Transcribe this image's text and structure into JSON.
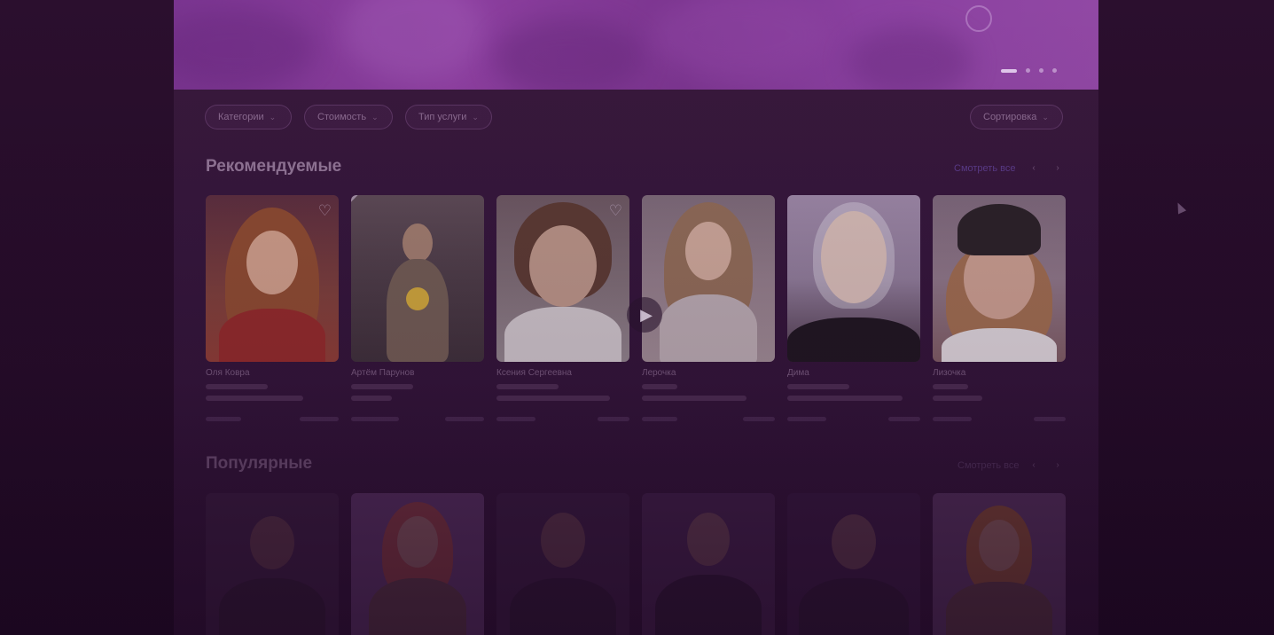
{
  "filters": [
    {
      "label": "Категории"
    },
    {
      "label": "Стоимость"
    },
    {
      "label": "Тип услуги"
    }
  ],
  "sort": {
    "label": "Сортировка"
  },
  "sections": {
    "recommended": {
      "title": "Рекомендуемые",
      "see_all": "Смотреть все"
    },
    "popular": {
      "title": "Популярные",
      "see_all": "Смотреть все"
    }
  },
  "recommended_cards": [
    {
      "name": "Оля Ковра"
    },
    {
      "name": "Артём Парунов"
    },
    {
      "name": "Ксения Сергеевна"
    },
    {
      "name": "Лерочка"
    },
    {
      "name": "Дима"
    },
    {
      "name": "Лизочка"
    }
  ],
  "hero": {
    "slides": 4,
    "active_slide": 1
  },
  "colors": {
    "accent": "#8d3fa0",
    "background": "#2a1030",
    "see_all_link": "#7a5ac8"
  },
  "icons": {
    "favorite": "heart-icon",
    "play": "play-icon",
    "dropdown": "chevron-down-icon",
    "prev": "chevron-left-icon",
    "next": "chevron-right-icon"
  }
}
